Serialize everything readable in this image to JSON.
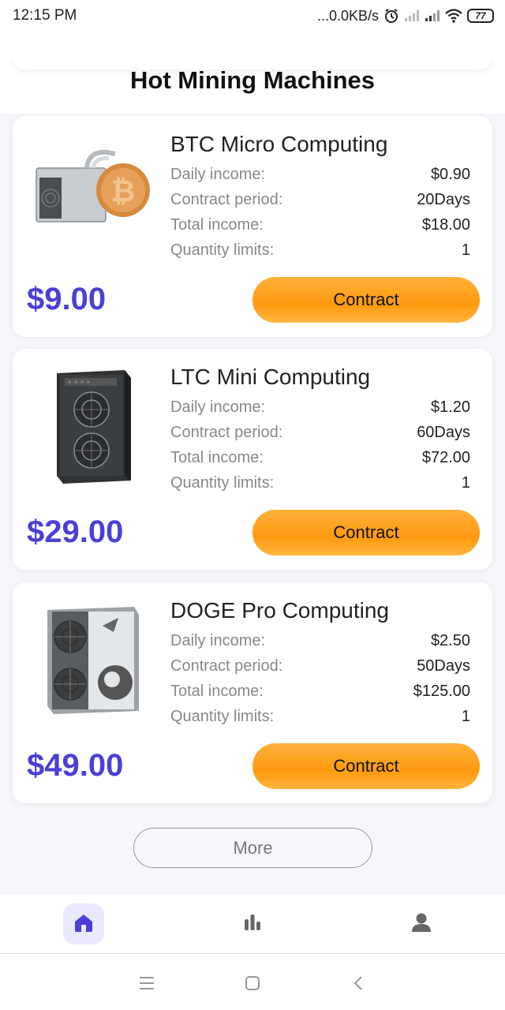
{
  "status_bar": {
    "time": "12:15 PM",
    "network_speed": "...0.0KB/s",
    "battery": "77",
    "icons": [
      "alarm-icon",
      "signal-icon",
      "signal-icon",
      "wifi-icon",
      "battery-icon"
    ]
  },
  "section": {
    "title": "Hot Mining Machines"
  },
  "labels": {
    "daily_income": "Daily income:",
    "contract_period": "Contract period:",
    "total_income": "Total income:",
    "quantity_limits": "Quantity limits:"
  },
  "products": [
    {
      "name": "BTC Micro Computing",
      "daily_income": "$0.90",
      "contract_period": "20Days",
      "total_income": "$18.00",
      "quantity_limits": "1",
      "price": "$9.00",
      "button_label": "Contract",
      "image_icon": "btc-miner-icon"
    },
    {
      "name": "LTC Mini Computing",
      "daily_income": "$1.20",
      "contract_period": "60Days",
      "total_income": "$72.00",
      "quantity_limits": "1",
      "price": "$29.00",
      "button_label": "Contract",
      "image_icon": "ltc-miner-icon"
    },
    {
      "name": "DOGE Pro Computing",
      "daily_income": "$2.50",
      "contract_period": "50Days",
      "total_income": "$125.00",
      "quantity_limits": "1",
      "price": "$49.00",
      "button_label": "Contract",
      "image_icon": "doge-miner-icon"
    }
  ],
  "more_button": "More",
  "bottom_nav": {
    "items": [
      {
        "icon": "home-icon",
        "active": true
      },
      {
        "icon": "chart-icon",
        "active": false
      },
      {
        "icon": "user-icon",
        "active": false
      }
    ]
  },
  "system_nav": [
    "menu-icon",
    "square-icon",
    "back-icon"
  ],
  "colors": {
    "price": "#4b3fd6",
    "button_orange": "#ff9a10",
    "nav_active_bg": "#ebe9ff",
    "nav_active_icon": "#4b3fd6"
  }
}
